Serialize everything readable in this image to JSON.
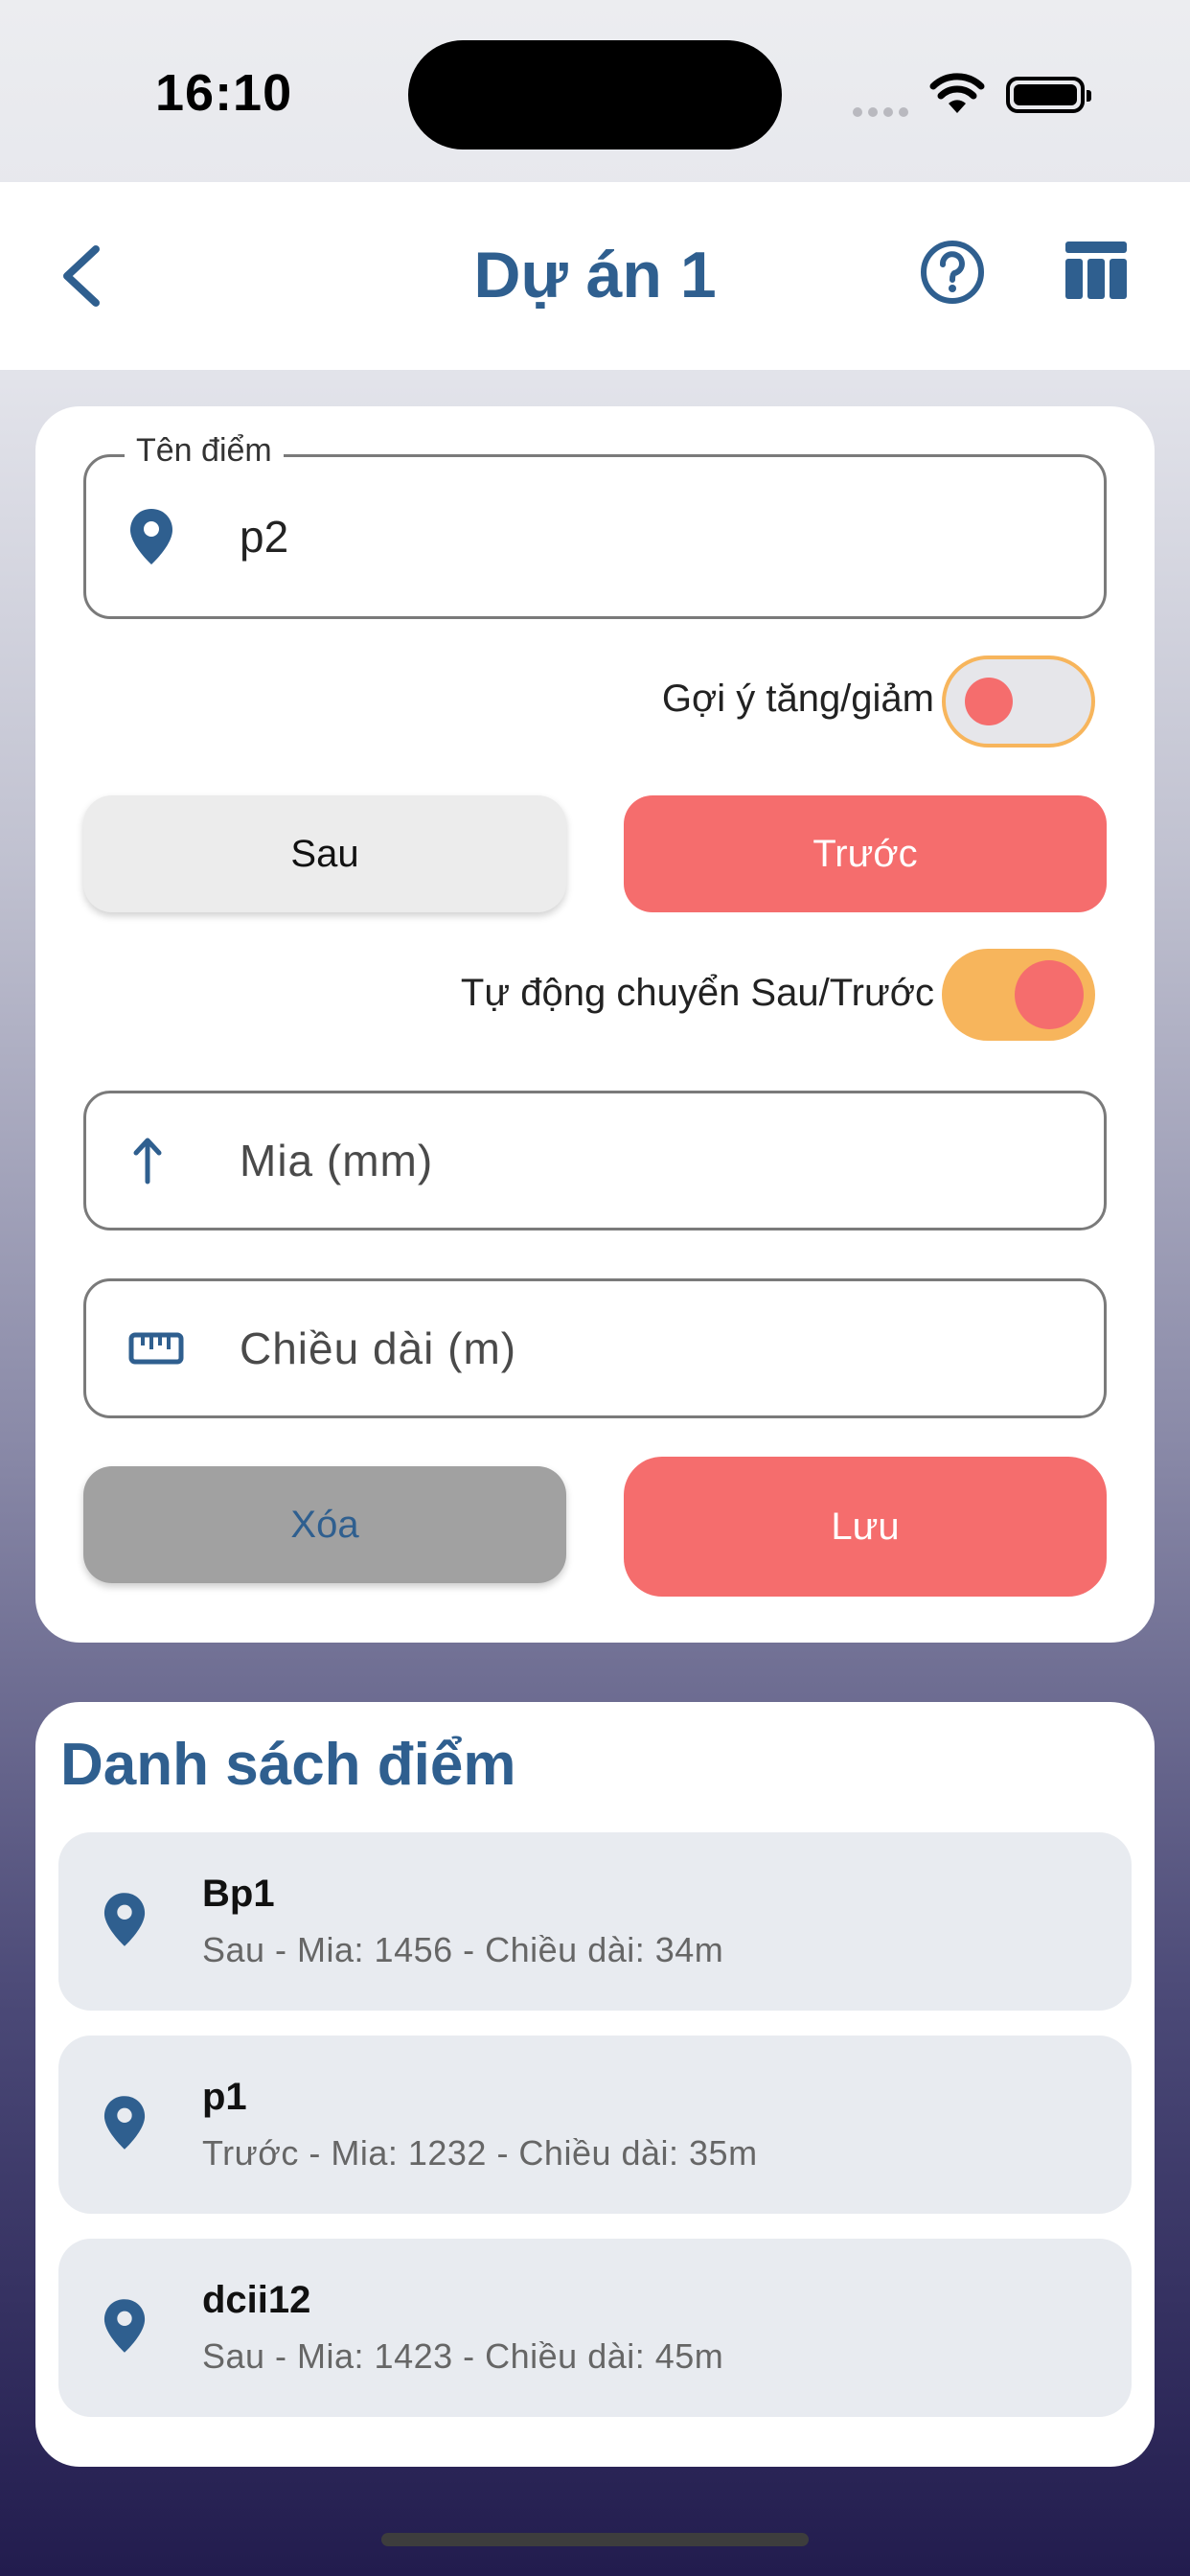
{
  "status": {
    "time": "16:10"
  },
  "header": {
    "title": "Dự án 1"
  },
  "form": {
    "point_name": {
      "label": "Tên điểm",
      "value": "p2"
    },
    "suggest_toggle": {
      "label": "Gợi ý tăng/giảm",
      "on": false
    },
    "segment": {
      "back_label": "Sau",
      "front_label": "Trước",
      "selected": "Trước"
    },
    "auto_switch_toggle": {
      "label": "Tự động chuyển Sau/Trước",
      "on": true
    },
    "staff_field": {
      "placeholder": "Mia (mm)"
    },
    "length_field": {
      "placeholder": "Chiều dài (m)"
    },
    "delete_label": "Xóa",
    "save_label": "Lưu"
  },
  "points_list": {
    "title": "Danh sách điểm",
    "items": [
      {
        "name": "Bp1",
        "detail": "Sau - Mia: 1456 - Chiều dài: 34m"
      },
      {
        "name": "p1",
        "detail": "Trước - Mia: 1232 - Chiều dài: 35m"
      },
      {
        "name": "dcii12",
        "detail": "Sau - Mia: 1423 - Chiều dài: 45m"
      }
    ]
  },
  "colors": {
    "primary": "#2f5f8f",
    "accent": "#f56d6d",
    "toggle_on": "#f7b55c"
  },
  "icons": [
    "back-chevron-icon",
    "help-circle-icon",
    "table-icon",
    "location-pin-icon",
    "arrow-up-icon",
    "ruler-icon"
  ]
}
